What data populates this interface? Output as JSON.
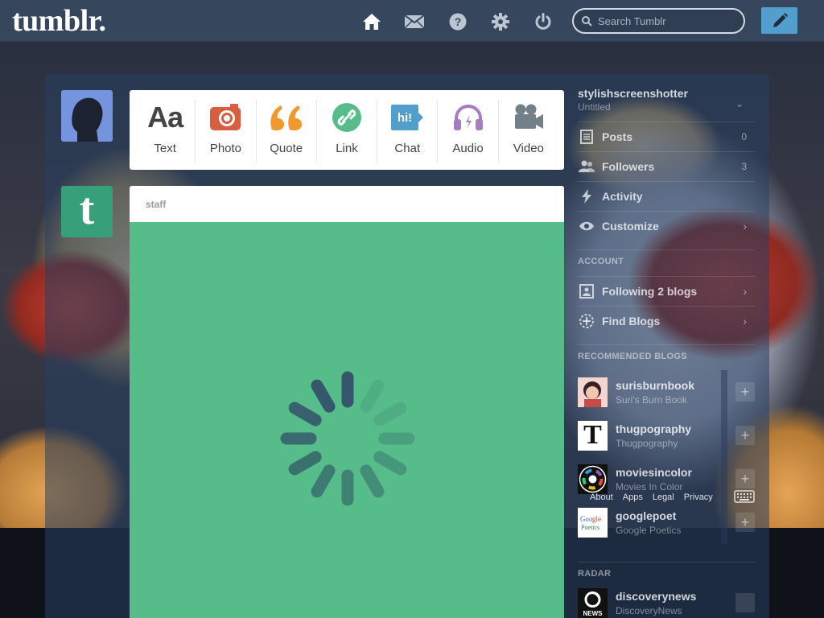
{
  "header": {
    "logo": "tumblr.",
    "search_placeholder": "Search Tumblr",
    "nav_icons": [
      "home-icon",
      "mail-icon",
      "help-icon",
      "gear-icon",
      "power-icon"
    ],
    "accent": "#529ecc",
    "bar_color": "#36465d"
  },
  "post_types": [
    {
      "label": "Text",
      "icon": "text-icon",
      "color": "#444444"
    },
    {
      "label": "Photo",
      "icon": "camera-icon",
      "color": "#d95e40"
    },
    {
      "label": "Quote",
      "icon": "quote-icon",
      "color": "#f2992e"
    },
    {
      "label": "Link",
      "icon": "link-icon",
      "color": "#56bc8a"
    },
    {
      "label": "Chat",
      "icon": "chat-icon",
      "color": "#529ecc"
    },
    {
      "label": "Audio",
      "icon": "headphones-icon",
      "color": "#a77dc2"
    },
    {
      "label": "Video",
      "icon": "video-camera-icon",
      "color": "#748089"
    }
  ],
  "post": {
    "blog": "staff",
    "background": "#56bc8a"
  },
  "sidebar": {
    "blog_name": "stylishscreenshotter",
    "blog_title": "Untitled",
    "items": [
      {
        "label": "Posts",
        "count": "0"
      },
      {
        "label": "Followers",
        "count": "3"
      },
      {
        "label": "Activity",
        "count": ""
      },
      {
        "label": "Customize",
        "count": ""
      }
    ],
    "account_heading": "ACCOUNT",
    "account_items": [
      {
        "label": "Following 2 blogs"
      },
      {
        "label": "Find Blogs"
      }
    ],
    "recommended_heading": "RECOMMENDED BLOGS",
    "recommended": [
      {
        "name": "surisburnbook",
        "title": "Suri's Burn Book"
      },
      {
        "name": "thugpography",
        "title": "Thugpography"
      },
      {
        "name": "moviesincolor",
        "title": "Movies In Color"
      },
      {
        "name": "googlepoet",
        "title": "Google Poetics"
      }
    ],
    "footer_links": [
      "About",
      "Apps",
      "Legal",
      "Privacy"
    ],
    "radar_heading": "RADAR",
    "radar": {
      "name": "discoverynews",
      "title": "DiscoveryNews"
    }
  }
}
